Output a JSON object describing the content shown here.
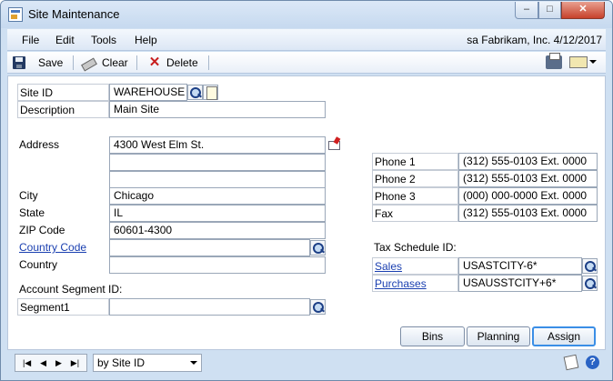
{
  "window": {
    "title": "Site Maintenance"
  },
  "menu": [
    "File",
    "Edit",
    "Tools",
    "Help"
  ],
  "user_info": "sa  Fabrikam, Inc.  4/12/2017",
  "toolbar": {
    "save": "Save",
    "clear": "Clear",
    "delete": "Delete"
  },
  "fields": {
    "site_id": {
      "label": "Site ID",
      "value": "WAREHOUSE"
    },
    "description": {
      "label": "Description",
      "value": "Main Site"
    },
    "address": {
      "label": "Address",
      "lines": [
        "4300 West Elm St.",
        "",
        ""
      ]
    },
    "city": {
      "label": "City",
      "value": "Chicago"
    },
    "state": {
      "label": "State",
      "value": "IL"
    },
    "zip": {
      "label": "ZIP Code",
      "value": "60601-4300"
    },
    "country_code": {
      "label": "Country Code",
      "value": ""
    },
    "country": {
      "label": "Country",
      "value": ""
    },
    "account_segment_header": "Account Segment ID:",
    "segment1": {
      "label": "Segment1",
      "value": ""
    },
    "phone1": {
      "label": "Phone 1",
      "value": "(312) 555-0103  Ext. 0000"
    },
    "phone2": {
      "label": "Phone 2",
      "value": "(312) 555-0103  Ext. 0000"
    },
    "phone3": {
      "label": "Phone 3",
      "value": "(000) 000-0000  Ext. 0000"
    },
    "fax": {
      "label": "Fax",
      "value": "(312) 555-0103  Ext. 0000"
    },
    "tax_schedule_header": "Tax Schedule ID:",
    "sales": {
      "label": "Sales",
      "value": "USASTCITY-6*"
    },
    "purchases": {
      "label": "Purchases",
      "value": "USAUSSTCITY+6*"
    }
  },
  "buttons": {
    "bins": "Bins",
    "planning": "Planning",
    "assign": "Assign"
  },
  "status": {
    "sort_by": "by Site ID"
  }
}
